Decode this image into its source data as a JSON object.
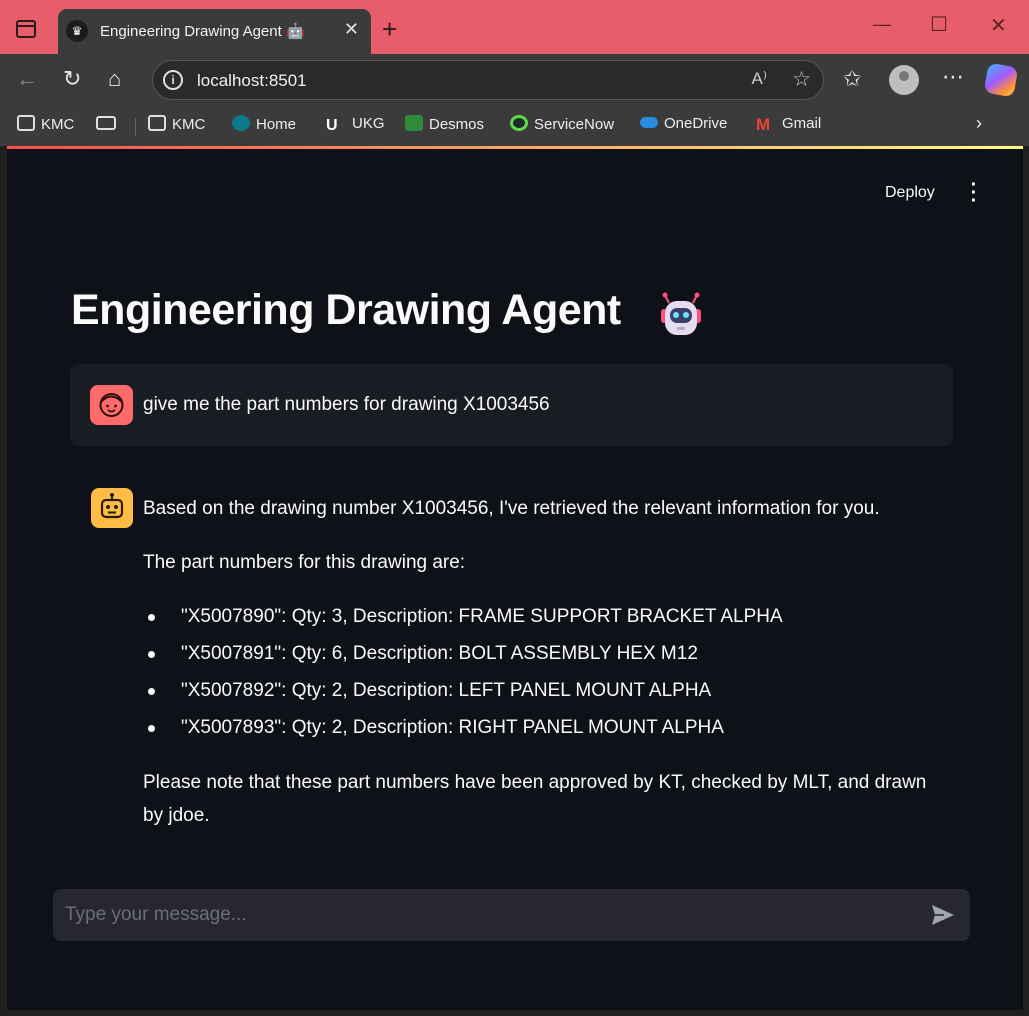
{
  "browser": {
    "tab_title": "Engineering Drawing Agent 🤖",
    "url": "localhost:8501",
    "bookmarks": [
      {
        "label": "KMC",
        "icon": "briefcase-folder-icon"
      },
      {
        "label": "",
        "icon": "tablet-icon"
      },
      {
        "label": "KMC",
        "icon": "folder-icon"
      },
      {
        "label": "Home",
        "icon": "sharepoint-icon"
      },
      {
        "label": "UKG",
        "icon": "ukg-icon"
      },
      {
        "label": "Desmos",
        "icon": "desmos-icon"
      },
      {
        "label": "ServiceNow",
        "icon": "servicenow-icon"
      },
      {
        "label": "OneDrive",
        "icon": "onedrive-icon"
      },
      {
        "label": "Gmail",
        "icon": "gmail-icon"
      }
    ]
  },
  "app": {
    "deploy_label": "Deploy",
    "title": "Engineering Drawing Agent",
    "messages": {
      "user": "give me the part numbers for drawing X1003456",
      "assistant_intro": "Based on the drawing number X1003456, I've retrieved the relevant information for you.",
      "assistant_lead": "The part numbers for this drawing are:",
      "parts": [
        "\"X5007890\": Qty: 3, Description: FRAME SUPPORT BRACKET ALPHA",
        "\"X5007891\": Qty: 6, Description: BOLT ASSEMBLY HEX M12",
        "\"X5007892\": Qty: 2, Description: LEFT PANEL MOUNT ALPHA",
        "\"X5007893\": Qty: 2, Description: RIGHT PANEL MOUNT ALPHA"
      ],
      "assistant_note": "Please note that these part numbers have been approved by KT, checked by MLT, and drawn by jdoe."
    },
    "chat_input_placeholder": "Type your message..."
  },
  "colors": {
    "titlebar": "#e85d6a",
    "app_bg": "#0e1117",
    "user_avatar": "#ff6b6b",
    "bot_avatar": "#ffbd45"
  }
}
